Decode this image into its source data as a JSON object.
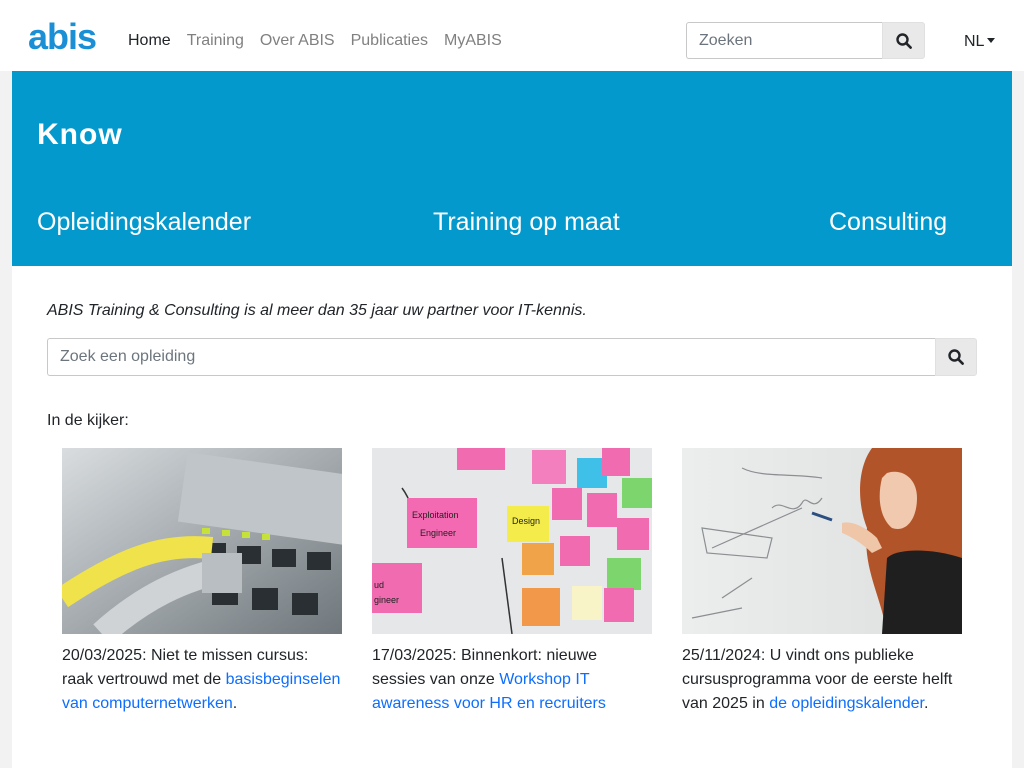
{
  "brand": {
    "logo_text": "abis",
    "logo_color": "#1a8fd6"
  },
  "nav": {
    "items": [
      {
        "label": "Home",
        "active": true
      },
      {
        "label": "Training",
        "active": false
      },
      {
        "label": "Over ABIS",
        "active": false
      },
      {
        "label": "Publicaties",
        "active": false
      },
      {
        "label": "MyABIS",
        "active": false
      }
    ],
    "search_placeholder": "Zoeken",
    "search_icon": "search-icon",
    "language": "NL"
  },
  "hero": {
    "title": "Know",
    "links": [
      "Opleidingskalender",
      "Training op maat",
      "Consulting"
    ],
    "background": "#0499cd"
  },
  "main": {
    "tagline": "ABIS Training & Consulting is al meer dan 35 jaar uw partner voor IT-kennis.",
    "course_search_placeholder": "Zoek een opleiding",
    "featured_label": "In de kijker:",
    "link_color": "#0d6efd"
  },
  "cards": [
    {
      "image": "network-switch-cables-photo",
      "text_before": "20/03/2025: Niet te missen cursus: raak vertrouwd met de ",
      "link": "basisbeginselen van computernetwerken",
      "text_after": "."
    },
    {
      "image": "sticky-notes-whiteboard-photo",
      "text_before": "17/03/2025: Binnenkort: nieuwe sessies van onze ",
      "link": "Workshop IT awareness voor HR en recruiters",
      "text_after": ""
    },
    {
      "image": "woman-drawing-on-whiteboard-photo",
      "text_before": "25/11/2024: U vindt ons publieke cursusprogramma voor de eerste helft van 2025 in ",
      "link": "de opleidingskalender",
      "text_after": "."
    }
  ]
}
